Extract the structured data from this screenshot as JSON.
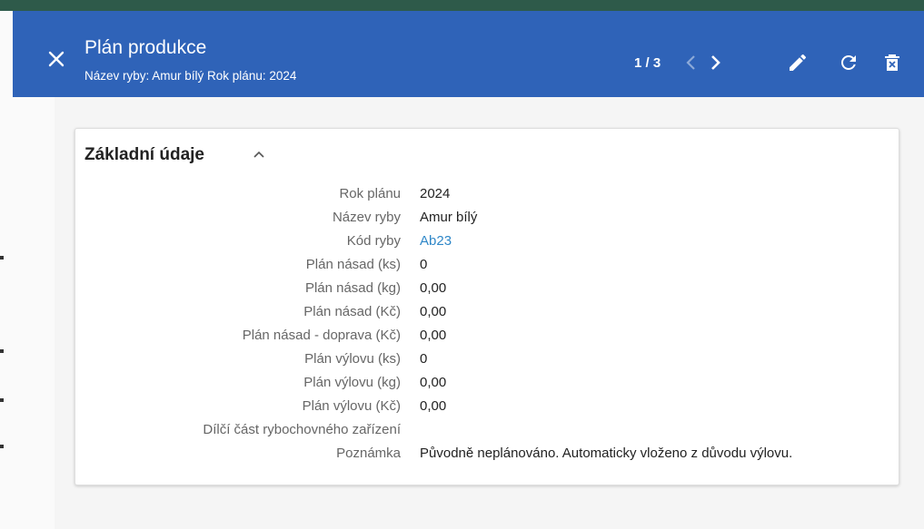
{
  "header": {
    "title": "Plán produkce",
    "subtitle": "Název ryby: Amur bílý Rok plánu: 2024",
    "pager": "1 / 3"
  },
  "section": {
    "title": "Základní údaje"
  },
  "fields": [
    {
      "label": "Rok plánu",
      "value": "2024"
    },
    {
      "label": "Název ryby",
      "value": "Amur bílý"
    },
    {
      "label": "Kód ryby",
      "value": "Ab23"
    },
    {
      "label": "Plán násad (ks)",
      "value": "0"
    },
    {
      "label": "Plán násad (kg)",
      "value": "0,00"
    },
    {
      "label": "Plán násad (Kč)",
      "value": "0,00"
    },
    {
      "label": "Plán násad - doprava (Kč)",
      "value": "0,00"
    },
    {
      "label": "Plán výlovu (ks)",
      "value": "0"
    },
    {
      "label": "Plán výlovu (kg)",
      "value": "0,00"
    },
    {
      "label": "Plán výlovu (Kč)",
      "value": "0,00"
    },
    {
      "label": "Dílčí část rybochovného zařízení",
      "value": ""
    },
    {
      "label": "Poznámka",
      "value": "Původně neplánováno. Automaticky vloženo z důvodu výlovu."
    }
  ],
  "icons": {
    "close": "close-icon",
    "prev": "chevron-left-icon",
    "next": "chevron-right-icon",
    "edit": "pencil-icon",
    "refresh": "refresh-icon",
    "delete": "delete-icon",
    "collapse": "chevron-up-icon"
  },
  "colors": {
    "header_bg": "#2f63b8",
    "link": "#2f87c8",
    "top_strip": "#2e5a4a"
  }
}
